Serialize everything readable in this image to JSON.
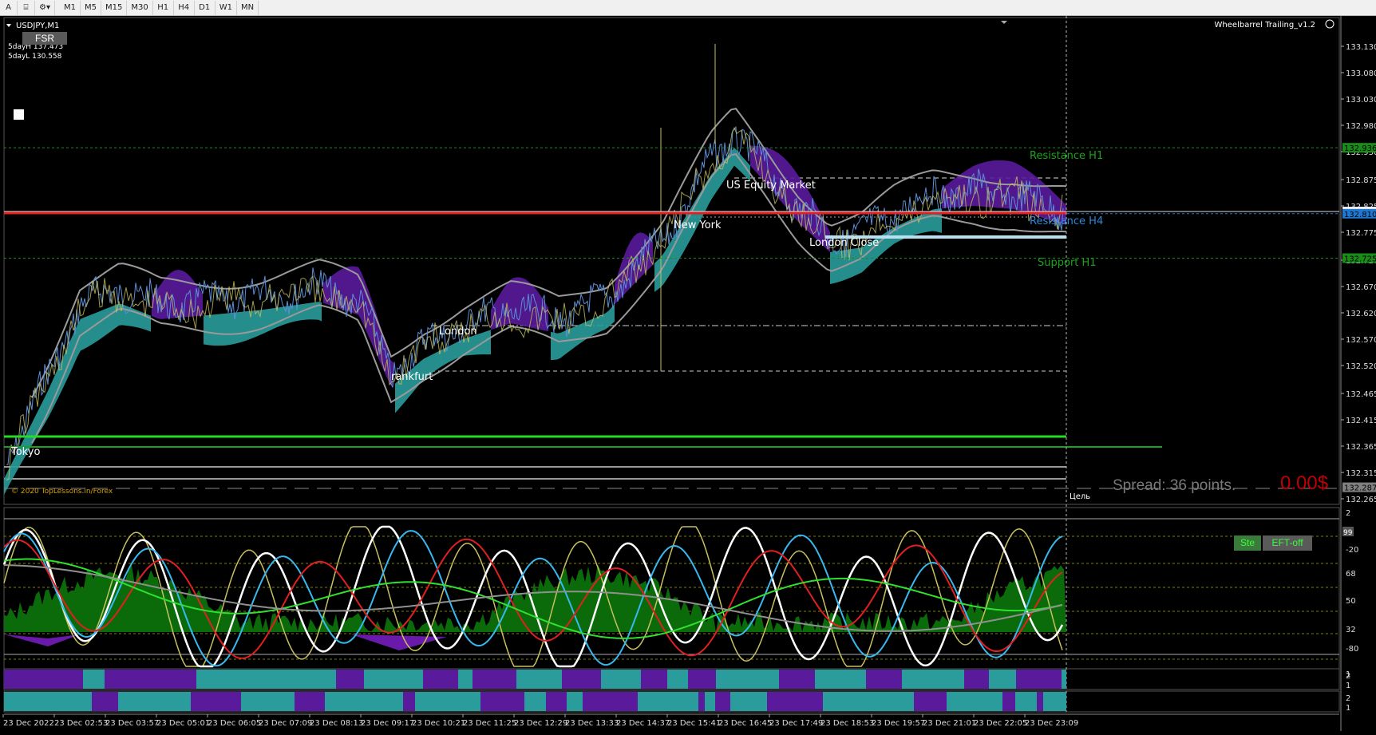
{
  "toolbar": {
    "tools": [
      {
        "label": "A",
        "icon": "text-tool-icon"
      },
      {
        "label": "⌸",
        "icon": "label-tool-icon"
      },
      {
        "label": "⚙▾",
        "icon": "shapes-dropdown-icon"
      }
    ],
    "timeframes": [
      "M1",
      "M5",
      "M15",
      "M30",
      "H1",
      "H4",
      "D1",
      "W1",
      "MN"
    ]
  },
  "chart": {
    "symbol_label": "USDJPY,M1",
    "fsr_button": "FSR",
    "five_day_high": "5dayH 137.473",
    "five_day_low": "5dayL 130.558",
    "ea_name": "Wheelbarrel Trailing_v1.2",
    "copyright": "© 2020 TopLessons.in/Forex",
    "target_label": "Цель",
    "spread_text": "Spread: 36 points.",
    "profit_text": "0.00$",
    "ste_label": "Ste",
    "eft_label": "EFT-off",
    "colors": {
      "teal": "#2a9c9c",
      "purple": "#5a1a9c",
      "support_green": "#1aa31a",
      "resistance_red": "#e02020",
      "price_axis_highlight": "#1e78d2"
    }
  },
  "price_axis": {
    "ticks": [
      "133.130",
      "133.080",
      "133.030",
      "132.980",
      "132.930",
      "132.875",
      "132.825",
      "132.775",
      "132.720",
      "132.670",
      "132.620",
      "132.570",
      "132.520",
      "132.465",
      "132.415",
      "132.365",
      "132.315",
      "132.265"
    ],
    "badges": [
      {
        "value": "132.936",
        "color": "#1a8c1a"
      },
      {
        "value": "132.814",
        "color": "#ffffff"
      },
      {
        "value": "132.810",
        "color": "#1e78d2"
      },
      {
        "value": "132.725",
        "color": "#1a8c1a"
      },
      {
        "value": "132.287",
        "color": "#808080"
      }
    ]
  },
  "session_labels": [
    {
      "text": "Tokyo",
      "name": "label-tokyo"
    },
    {
      "text": "rankfurt",
      "name": "label-frankfurt"
    },
    {
      "text": "London",
      "name": "label-london"
    },
    {
      "text": "New York",
      "name": "label-new-york"
    },
    {
      "text": "US Equity Market",
      "name": "label-us-equity"
    },
    {
      "text": "London Close",
      "name": "label-london-close"
    }
  ],
  "level_labels": {
    "resistance_h1": "Resistance H1",
    "resistance_h4": "Resistance H4",
    "support_h1": "Support H1"
  },
  "indicator_axis": {
    "ticks": [
      "2",
      "-20",
      "68",
      "50",
      "32",
      "-80",
      "1"
    ],
    "badge": "99"
  },
  "bar_axes": {
    "strip1_ticks": [
      "2",
      "1"
    ],
    "strip2_ticks": [
      "2",
      "1"
    ]
  },
  "time_axis": {
    "labels": [
      "23 Dec 2022",
      "23 Dec 02:53",
      "23 Dec 03:57",
      "23 Dec 05:01",
      "23 Dec 06:05",
      "23 Dec 07:09",
      "23 Dec 08:13",
      "23 Dec 09:17",
      "23 Dec 10:21",
      "23 Dec 11:25",
      "23 Dec 12:29",
      "23 Dec 13:33",
      "23 Dec 14:37",
      "23 Dec 15:41",
      "23 Dec 16:45",
      "23 Dec 17:49",
      "23 Dec 18:53",
      "23 Dec 19:57",
      "23 Dec 21:01",
      "23 Dec 22:05",
      "23 Dec 23:09"
    ]
  }
}
